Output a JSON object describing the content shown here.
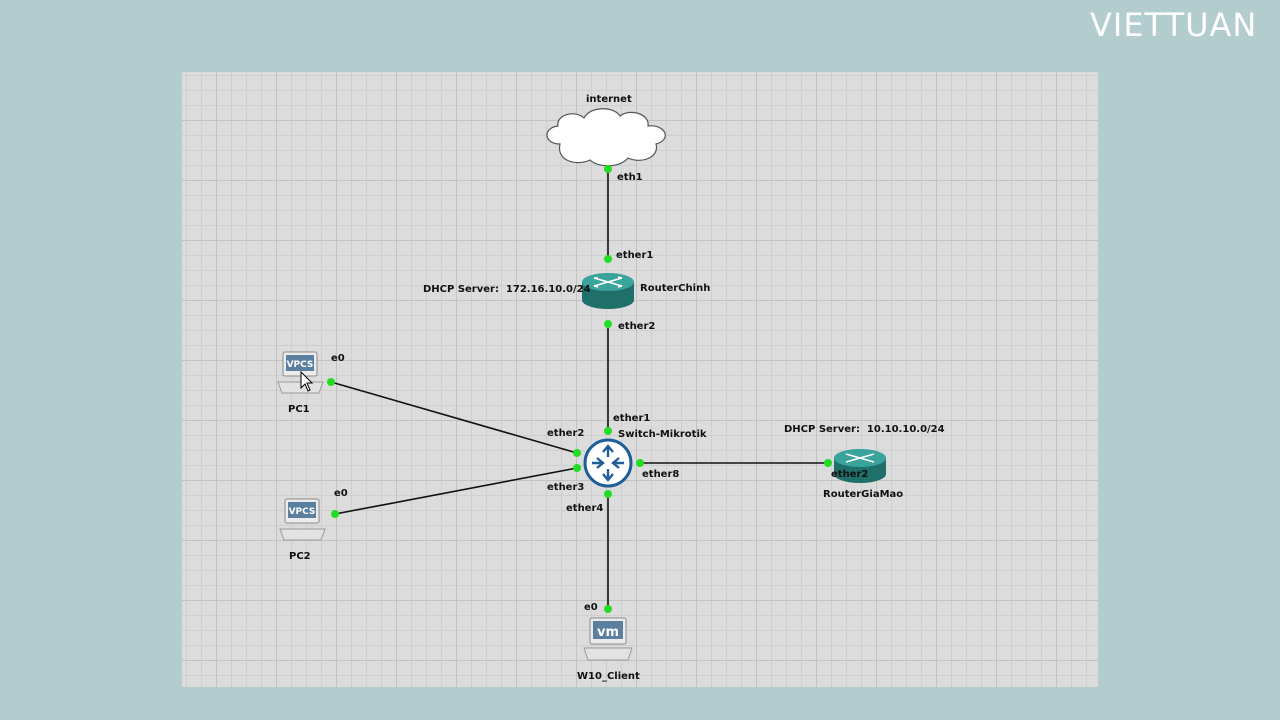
{
  "brand": {
    "text": "VIETTUAN"
  },
  "nodes": {
    "internet": {
      "label": "internet",
      "icon": "cloud-icon"
    },
    "router_chinh": {
      "label": "RouterChinh",
      "icon": "router-icon",
      "note": "DHCP Server:  172.16.10.0/24"
    },
    "switch": {
      "label": "Switch-Mikrotik",
      "icon": "switch-icon"
    },
    "router_gia_mao": {
      "label": "RouterGiaMao",
      "icon": "router-icon",
      "note": "DHCP Server:  10.10.10.0/24"
    },
    "pc1": {
      "label": "PC1",
      "icon": "vpcs-icon",
      "badge": "VPCS"
    },
    "pc2": {
      "label": "PC2",
      "icon": "vpcs-icon",
      "badge": "VPCS"
    },
    "w10": {
      "label": "W10_Client",
      "icon": "vm-icon",
      "badge": "vm"
    }
  },
  "ports": {
    "internet_eth1": "eth1",
    "rc_ether1": "ether1",
    "rc_ether2": "ether2",
    "sw_ether1": "ether1",
    "sw_ether2": "ether2",
    "sw_ether3": "ether3",
    "sw_ether4": "ether4",
    "sw_ether8": "ether8",
    "rgm_ether2": "ether2",
    "pc1_e0": "e0",
    "pc2_e0": "e0",
    "w10_e0": "e0"
  },
  "colors": {
    "port_dot": "#22dd22",
    "link": "#111111",
    "router": "#2e8c86",
    "switch": "#1f5f99"
  }
}
